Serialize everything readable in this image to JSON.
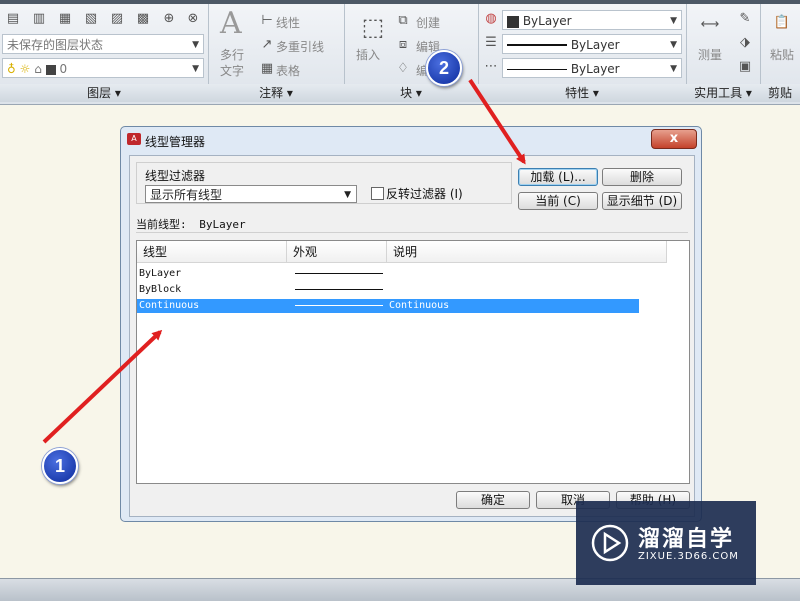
{
  "ribbon": {
    "layer": {
      "state_combo": "未保存的图层状态",
      "layer_combo": "0",
      "title": "图层"
    },
    "annotation": {
      "multiline_text": "多行",
      "multiline_text2": "文字",
      "linear": "线性",
      "multileader": "多重引线",
      "table": "表格",
      "title": "注释"
    },
    "block": {
      "insert": "插入",
      "create": "创建",
      "edit": "编辑",
      "edit_attr": "编",
      "title": "块"
    },
    "properties": {
      "color": "ByLayer",
      "lineweight": "ByLayer",
      "linetype": "ByLayer",
      "title": "特性"
    },
    "utilities": {
      "measure": "测量",
      "title": "实用工具"
    },
    "clipboard": {
      "paste": "粘贴",
      "title": "剪贴"
    }
  },
  "dialog": {
    "title": "线型管理器",
    "close": "x",
    "logo": "A",
    "filter_group_label": "线型过滤器",
    "filter_value": "显示所有线型",
    "invert_filter": "反转过滤器 (I)",
    "buttons": {
      "load": "加载 (L)...",
      "delete": "删除",
      "current": "当前 (C)",
      "show_details": "显示细节 (D)",
      "ok": "确定",
      "cancel": "取消",
      "help": "帮助 (H)"
    },
    "current_linetype_label": "当前线型:",
    "current_linetype_value": "ByLayer",
    "columns": [
      "线型",
      "外观",
      "说明"
    ],
    "rows": [
      {
        "name": "ByLayer",
        "description": "",
        "selected": false
      },
      {
        "name": "ByBlock",
        "description": "",
        "selected": false
      },
      {
        "name": "Continuous",
        "description": "Continuous",
        "selected": true
      }
    ]
  },
  "annotations": {
    "badge1": "1",
    "badge2": "2",
    "arrow_color": "#e02020"
  },
  "watermark": {
    "main": "溜溜自学",
    "sub": "ZIXUE.3D66.COM"
  }
}
